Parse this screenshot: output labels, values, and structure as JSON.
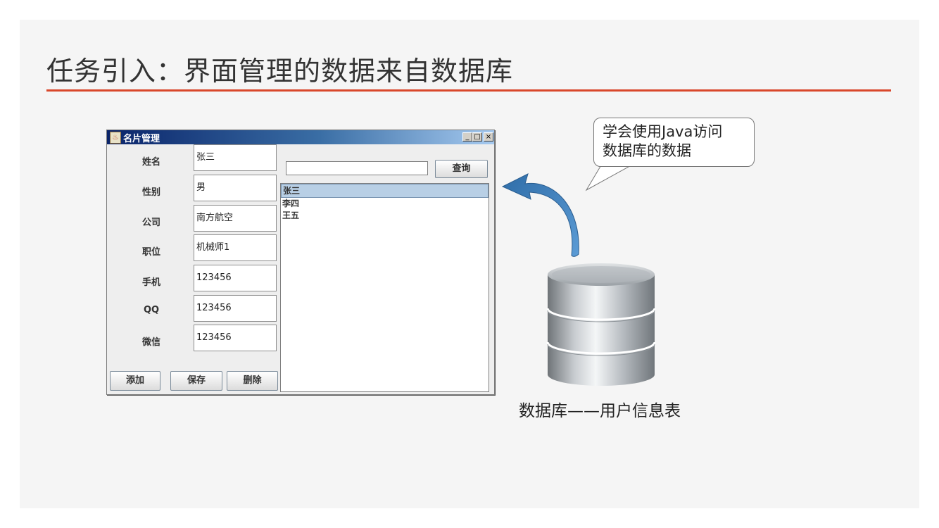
{
  "slide": {
    "title": "任务引入：界面管理的数据来自数据库",
    "accent_color": "#d9472b"
  },
  "window": {
    "title": "名片管理",
    "icon": "java-cup-icon",
    "controls": [
      "_",
      "□",
      "×"
    ],
    "fields": [
      {
        "label": "姓名",
        "value": "张三"
      },
      {
        "label": "性别",
        "value": "男"
      },
      {
        "label": "公司",
        "value": "南方航空"
      },
      {
        "label": "职位",
        "value": "机械师1"
      },
      {
        "label": "手机",
        "value": "123456"
      },
      {
        "label": "QQ",
        "value": "123456"
      },
      {
        "label": "微信",
        "value": "123456"
      }
    ],
    "search": {
      "value": "",
      "button_label": "查询"
    },
    "list_items": [
      "张三",
      "李四",
      "王五"
    ],
    "selected_index": 0,
    "buttons": {
      "add": "添加",
      "save": "保存",
      "delete": "删除"
    }
  },
  "callout": {
    "line1": "学会使用Java访问",
    "line2": "数据库的数据"
  },
  "database": {
    "icon": "database-cylinder-icon",
    "caption": "数据库——用户信息表"
  }
}
